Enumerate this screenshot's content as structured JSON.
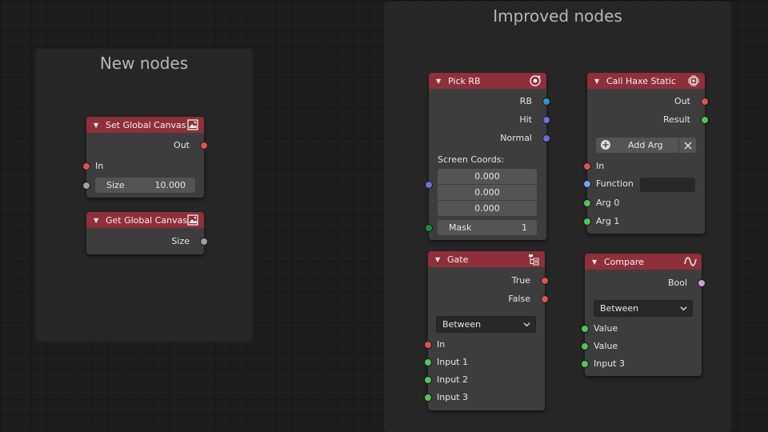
{
  "frames": {
    "new_nodes_title": "New nodes",
    "improved_nodes_title": "Improved nodes"
  },
  "colors": {
    "header": "#8f2f3a",
    "socket_red": "#d9534f",
    "socket_gray": "#a0a0a0",
    "socket_blue": "#2f95d2",
    "socket_purple": "#6e6ed8",
    "socket_green": "#58c25c",
    "socket_darkgreen": "#1f8a3e",
    "socket_lightblue": "#6fa6f0",
    "socket_pink": "#c7a0d8"
  },
  "set_global_canvas": {
    "title": "Set Global Canvas ...",
    "icon": "image-icon",
    "output_out": "Out",
    "input_in": "In",
    "size_label": "Size",
    "size_value": "10.000"
  },
  "get_global_canvas": {
    "title": "Get Global Canvas ...",
    "icon": "image-icon",
    "output_size": "Size"
  },
  "pick_rb": {
    "title": "Pick RB",
    "icon": "target-icon",
    "output_rb": "RB",
    "output_hit": "Hit",
    "output_normal": "Normal",
    "screen_coords_label": "Screen Coords:",
    "coord_values": [
      "0.000",
      "0.000",
      "0.000"
    ],
    "mask_label": "Mask",
    "mask_value": "1"
  },
  "call_haxe_static": {
    "title": "Call Haxe Static",
    "icon": "chip-icon",
    "output_out": "Out",
    "output_result": "Result",
    "add_arg_label": "Add Arg",
    "input_in": "In",
    "input_function": "Function",
    "function_value": "",
    "input_arg0": "Arg 0",
    "input_arg1": "Arg 1"
  },
  "gate": {
    "title": "Gate",
    "icon": "hierarchy-icon",
    "output_true": "True",
    "output_false": "False",
    "mode_selected": "Between",
    "input_in": "In",
    "input_1": "Input 1",
    "input_2": "Input 2",
    "input_3": "Input 3"
  },
  "compare": {
    "title": "Compare",
    "icon": "wave-icon",
    "output_bool": "Bool",
    "mode_selected": "Between",
    "input_value_1": "Value",
    "input_value_2": "Value",
    "input_3": "Input 3"
  }
}
